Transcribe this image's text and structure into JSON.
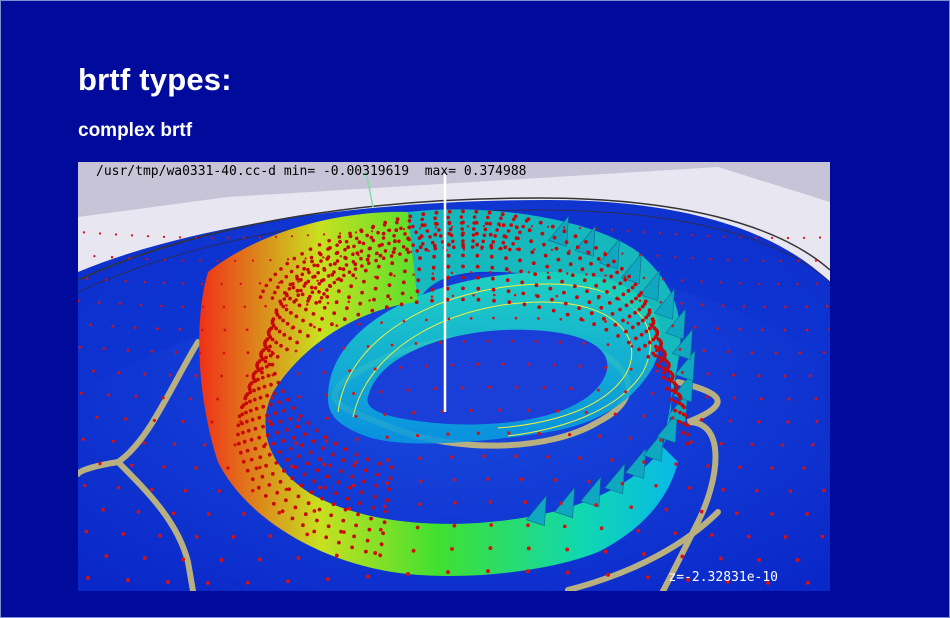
{
  "slide": {
    "title": "brtf types:",
    "subtitle": "complex brtf"
  },
  "plot": {
    "file_path": "/usr/tmp/wa0331-40.cc-d",
    "min_label": "min=",
    "min_value": "-0.00319619",
    "max_label": "max=",
    "max_value": "0.374988",
    "z_readout": "z=-2.32831e-10"
  },
  "colors": {
    "background": "#000b9c",
    "surface_low": "#1636d8",
    "surface_mid": "#00c8e8",
    "surface_high": "#30e030",
    "points": "#d81010",
    "contour": "#b8b080",
    "sky": "#c8c4d8"
  }
}
